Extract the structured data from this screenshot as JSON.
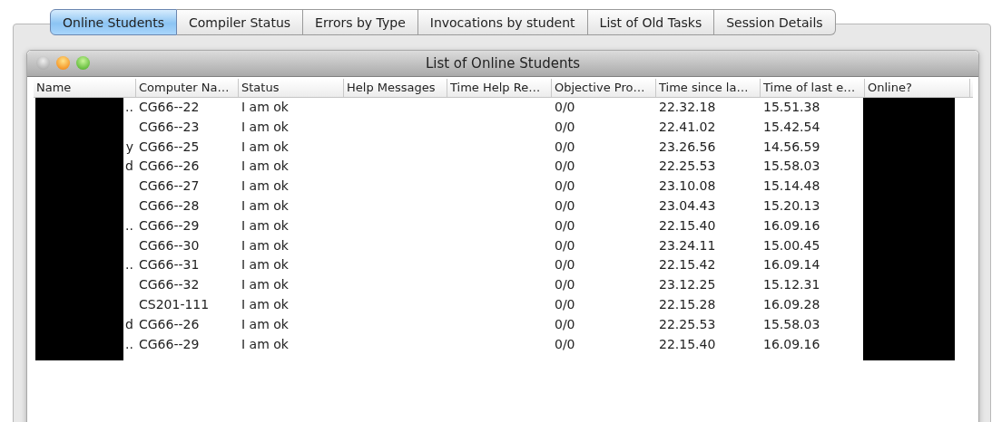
{
  "tabs": [
    {
      "label": "Online Students",
      "selected": true
    },
    {
      "label": "Compiler Status",
      "selected": false
    },
    {
      "label": "Errors by Type",
      "selected": false
    },
    {
      "label": "Invocations by student",
      "selected": false
    },
    {
      "label": "List of Old Tasks",
      "selected": false
    },
    {
      "label": "Session Details",
      "selected": false
    }
  ],
  "window": {
    "title": "List of Online Students"
  },
  "table": {
    "columns": [
      {
        "label": "Name",
        "kind": "redacted"
      },
      {
        "label": "Computer Na…",
        "kind": "text"
      },
      {
        "label": "Status",
        "kind": "text"
      },
      {
        "label": "Help Messages",
        "kind": "text"
      },
      {
        "label": "Time Help Re…",
        "kind": "text"
      },
      {
        "label": "Objective Pro…",
        "kind": "text"
      },
      {
        "label": "Time since la…",
        "kind": "text"
      },
      {
        "label": "Time of last e…",
        "kind": "text"
      },
      {
        "label": "Online?",
        "kind": "redacted"
      }
    ],
    "rows": [
      {
        "cells": [
          "..",
          "CG66--22",
          "I am ok",
          "",
          "",
          "0/0",
          "22.32.18",
          "15.51.38",
          ""
        ]
      },
      {
        "cells": [
          "",
          "CG66--23",
          "I am ok",
          "",
          "",
          "0/0",
          "22.41.02",
          "15.42.54",
          ""
        ]
      },
      {
        "cells": [
          "y",
          "CG66--25",
          "I am ok",
          "",
          "",
          "0/0",
          "23.26.56",
          "14.56.59",
          ""
        ]
      },
      {
        "cells": [
          "d",
          "CG66--26",
          "I am ok",
          "",
          "",
          "0/0",
          "22.25.53",
          "15.58.03",
          ""
        ]
      },
      {
        "cells": [
          "",
          "CG66--27",
          "I am ok",
          "",
          "",
          "0/0",
          "23.10.08",
          "15.14.48",
          ""
        ]
      },
      {
        "cells": [
          "",
          "CG66--28",
          "I am ok",
          "",
          "",
          "0/0",
          "23.04.43",
          "15.20.13",
          ""
        ]
      },
      {
        "cells": [
          "..",
          "CG66--29",
          "I am ok",
          "",
          "",
          "0/0",
          "22.15.40",
          "16.09.16",
          ""
        ]
      },
      {
        "cells": [
          "",
          "CG66--30",
          "I am ok",
          "",
          "",
          "0/0",
          "23.24.11",
          "15.00.45",
          ""
        ]
      },
      {
        "cells": [
          "..",
          "CG66--31",
          "I am ok",
          "",
          "",
          "0/0",
          "22.15.42",
          "16.09.14",
          ""
        ]
      },
      {
        "cells": [
          "",
          "CG66--32",
          "I am ok",
          "",
          "",
          "0/0",
          "23.12.25",
          "15.12.31",
          ""
        ]
      },
      {
        "cells": [
          "",
          "CS201-111",
          "I am ok",
          "",
          "",
          "0/0",
          "22.15.28",
          "16.09.28",
          ""
        ]
      },
      {
        "cells": [
          "d",
          "CG66--26",
          "I am ok",
          "",
          "",
          "0/0",
          "22.25.53",
          "15.58.03",
          ""
        ]
      },
      {
        "cells": [
          "..",
          "CG66--29",
          "I am ok",
          "",
          "",
          "0/0",
          "22.15.40",
          "16.09.16",
          ""
        ]
      }
    ]
  }
}
